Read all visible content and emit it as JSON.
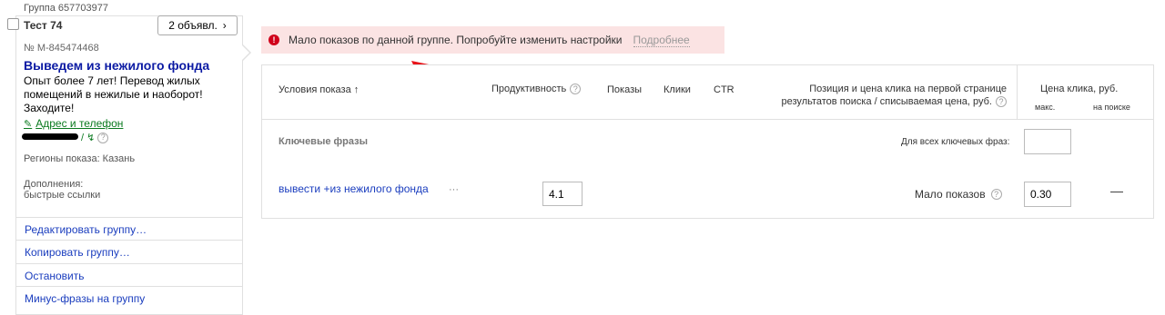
{
  "group": {
    "label": "Группа 657703977",
    "title": "Тест 74",
    "ads_button": "2 объявл.",
    "ads_button_chevron": "›"
  },
  "ad": {
    "number": "№ M-845474468",
    "headline": "Выведем из нежилого фонда",
    "text": "Опыт более 7 лет! Перевод жилых помещений в нежилые и наоборот! Заходите!",
    "contact_link": "Адрес и телефон",
    "sitelink_separator": "/",
    "regions": "Регионы показа: Казань",
    "extras_label": "Дополнения:",
    "extras_value": "быстрые ссылки"
  },
  "actions": [
    "Редактировать группу…",
    "Копировать группу…",
    "Остановить",
    "Минус-фразы на группу"
  ],
  "alert": {
    "icon": "!",
    "message": "Мало показов по данной группе. Попробуйте изменить настройки",
    "more": "Подробнее"
  },
  "table": {
    "headers": {
      "conditions": "Условия показа",
      "sort_arrow": "↑",
      "productivity": "Продуктивность",
      "impressions": "Показы",
      "clicks": "Клики",
      "ctr": "CTR",
      "position_line1": "Позиция и цена клика на первой странице",
      "position_line2": "результатов поиска / списываемая цена, руб.",
      "price": "Цена клика, руб.",
      "price_max": "макс.",
      "price_search": "на поиске"
    },
    "section_label": "Ключевые фразы",
    "all_phrases_label": "Для всех ключевых фраз:",
    "all_phrases_value": "",
    "rows": [
      {
        "phrase": "вывести +из нежилого фонда",
        "more": "···",
        "productivity": "4.1",
        "status": "Мало показов",
        "max_price": "0.30",
        "search_price": "—"
      }
    ]
  },
  "icons": {
    "help": "?",
    "phone": "✎",
    "ad_extra": "↯"
  },
  "colors": {
    "alert_bg": "#fbe3e3",
    "alert_icon": "#d0021b",
    "link": "#1a3dbe",
    "headline": "#0b1aa3",
    "green_link": "#0a7a1f",
    "annotation_arrow": "#e8141a"
  }
}
